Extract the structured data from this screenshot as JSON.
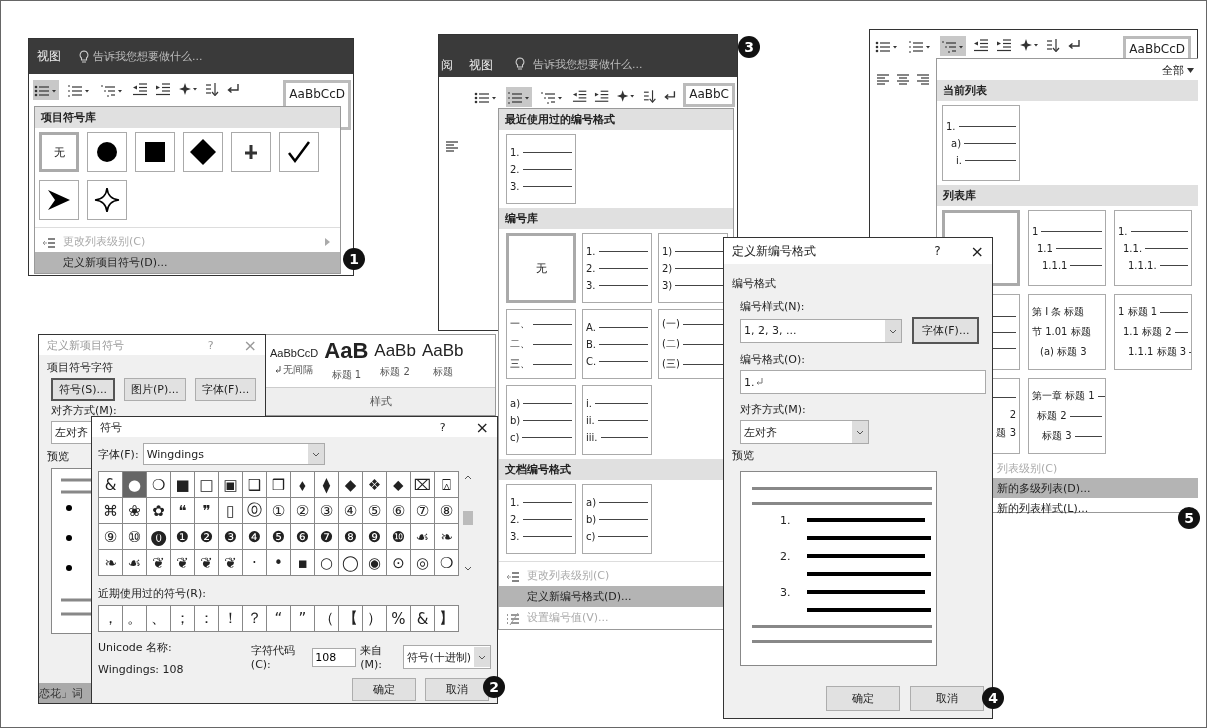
{
  "bullet_window": {
    "step": "1",
    "tabs": [
      "视图"
    ],
    "search": {
      "placeholder": "告诉我您想要做什么..."
    },
    "style_preview": "AaBbCcD",
    "toolbar_buttons": [
      {
        "kind": "bullets",
        "active": true
      },
      {
        "kind": "numbering",
        "active": false
      },
      {
        "kind": "multilevel",
        "active": false
      }
    ],
    "menu": {
      "heading": "项目符号库",
      "symbols": [
        {
          "kind": "none",
          "label": "无",
          "selected": true
        },
        {
          "kind": "disc",
          "selected": false
        },
        {
          "kind": "square",
          "selected": false
        },
        {
          "kind": "diamond",
          "selected": false
        },
        {
          "kind": "cross",
          "selected": false
        },
        {
          "kind": "check",
          "selected": false
        },
        {
          "kind": "arrowhead",
          "selected": false
        },
        {
          "kind": "star",
          "selected": false
        }
      ],
      "items": [
        {
          "label": "更改列表级别(C)",
          "disabled": true,
          "selected": false,
          "submenu": true
        },
        {
          "label": "定义新项目符号(D)...",
          "disabled": false,
          "selected": true,
          "submenu": false
        }
      ]
    }
  },
  "numbering_window": {
    "step": "3",
    "tabs": [
      "阅",
      "视图"
    ],
    "search": {
      "placeholder": "告诉我您想要做什么..."
    },
    "style_preview": "AaBbC",
    "toolbar_buttons": [
      {
        "kind": "bullets",
        "active": false
      },
      {
        "kind": "numbering",
        "active": true
      },
      {
        "kind": "multilevel",
        "active": false
      }
    ],
    "menu": {
      "sections": [
        {
          "heading": "最近使用过的编号格式",
          "tiles": [
            {
              "kind": "lines",
              "lines": [
                "1.",
                "2.",
                "3."
              ],
              "selected": false
            }
          ]
        },
        {
          "heading": "编号库",
          "tiles": [
            {
              "kind": "none",
              "label": "无",
              "selected": true
            },
            {
              "kind": "lines",
              "lines": [
                "1.",
                "2.",
                "3."
              ],
              "selected": false
            },
            {
              "kind": "lines",
              "lines": [
                "1)",
                "2)",
                "3)"
              ],
              "selected": false
            },
            {
              "kind": "lines",
              "lines": [
                "一、",
                "二、",
                "三、"
              ],
              "selected": false
            },
            {
              "kind": "lines",
              "lines": [
                "A.",
                "B.",
                "C."
              ],
              "selected": false
            },
            {
              "kind": "lines",
              "lines": [
                "(一)",
                "(二)",
                "(三)"
              ],
              "selected": false
            },
            {
              "kind": "lines",
              "lines": [
                "a)",
                "b)",
                "c)"
              ],
              "selected": false
            },
            {
              "kind": "lines",
              "lines": [
                "i.",
                "ii.",
                "iii."
              ],
              "selected": false
            }
          ]
        },
        {
          "heading": "文档编号格式",
          "tiles": [
            {
              "kind": "lines",
              "lines": [
                "1.",
                "2.",
                "3."
              ],
              "selected": false
            },
            {
              "kind": "lines",
              "lines": [
                "a)",
                "b)",
                "c)"
              ],
              "selected": false
            }
          ]
        }
      ],
      "items": [
        {
          "label": "更改列表级别(C)",
          "disabled": true,
          "selected": false
        },
        {
          "label": "定义新编号格式(D)...",
          "disabled": false,
          "selected": true
        },
        {
          "label": "设置编号值(V)...",
          "disabled": true,
          "selected": false
        }
      ]
    }
  },
  "multilevel_window": {
    "step": "5",
    "style_preview": "AaBbCcD",
    "toolbar_buttons": [
      {
        "kind": "bullets",
        "active": false
      },
      {
        "kind": "numbering",
        "active": false
      },
      {
        "kind": "multilevel",
        "active": true
      }
    ],
    "menu": {
      "filter": "全部",
      "sections": [
        {
          "heading": "当前列表",
          "tiles": [
            {
              "kind": "lines",
              "lines": [
                "1.",
                "a)",
                "i."
              ],
              "selected": false
            }
          ]
        },
        {
          "heading": "列表库",
          "tiles": [
            {
              "kind": "none",
              "selected": true
            },
            {
              "kind": "lines",
              "lines": [
                "1",
                "1.1",
                "1.1.1"
              ],
              "selected": false
            },
            {
              "kind": "lines",
              "lines": [
                "1.",
                "1.1.",
                "1.1.1."
              ],
              "selected": false
            },
            {
              "kind": "blank_lines",
              "selected": false
            },
            {
              "kind": "text",
              "lines": [
                "第 I 条 标题",
                "节 1.01 标题",
                "(a) 标题 3"
              ],
              "selected": false
            },
            {
              "kind": "lines",
              "lines": [
                "1 标题 1",
                "1.1 标题 2",
                "1.1.1 标题 3"
              ],
              "selected": false
            },
            {
              "kind": "clipped",
              "lines": [
                "2",
                "题 3"
              ],
              "selected": false
            },
            {
              "kind": "lines",
              "lines": [
                "第一章 标题 1",
                "标题 2",
                "标题 3"
              ],
              "selected": false
            }
          ]
        }
      ],
      "items": [
        {
          "label": "列表级别(C)",
          "disabled": true,
          "selected": false
        },
        {
          "label": "新的多级列表(D)...",
          "disabled": false,
          "selected": true
        },
        {
          "label": "新的列表样式(L)...",
          "disabled": false,
          "selected": false
        }
      ]
    }
  },
  "define_bullet_dialog": {
    "step": "2",
    "title": "定义新项目符号",
    "help": "?",
    "close": "×",
    "group": "项目符号字符",
    "buttons": [
      {
        "label": "符号(S)...",
        "default": true
      },
      {
        "label": "图片(P)...",
        "default": false
      },
      {
        "label": "字体(F)...",
        "default": false
      }
    ],
    "alignment_label": "对齐方式(M):",
    "alignment_value": "左对齐",
    "preview_label": "预览",
    "document_text": "恋花」词"
  },
  "styles_gallery": {
    "styles": [
      {
        "kind": "normal",
        "preview": "AaBbCcD",
        "name": "无间隔"
      },
      {
        "kind": "heading1",
        "preview": "AaB",
        "name": "标题 1"
      },
      {
        "kind": "heading2",
        "preview": "AaBb",
        "name": "标题 2"
      },
      {
        "kind": "title",
        "preview": "AaBb",
        "name": "标题"
      }
    ],
    "group_label": "样式"
  },
  "symbol_dialog": {
    "title": "符号",
    "help": "?",
    "close": "×",
    "font_label": "字体(F):",
    "font_value": "Wingdings",
    "rows": [
      [
        {
          "char": "&",
          "selected": false
        },
        {
          "char": "●",
          "selected": true
        },
        {
          "char": "❍",
          "selected": false
        },
        {
          "char": "■",
          "selected": false
        },
        {
          "char": "□",
          "selected": false
        },
        {
          "char": "▣",
          "selected": false
        },
        {
          "char": "❑",
          "selected": false
        },
        {
          "char": "❒",
          "selected": false
        },
        {
          "char": "⬧",
          "selected": false
        },
        {
          "char": "⧫",
          "selected": false
        },
        {
          "char": "◆",
          "selected": false
        },
        {
          "char": "❖",
          "selected": false
        },
        {
          "char": "⬥",
          "selected": false
        },
        {
          "char": "⌧",
          "selected": false
        },
        {
          "char": "⍓",
          "selected": false
        }
      ],
      [
        {
          "char": "⌘",
          "selected": false
        },
        {
          "char": "❀",
          "selected": false
        },
        {
          "char": "✿",
          "selected": false
        },
        {
          "char": "❝",
          "selected": false
        },
        {
          "char": "❞",
          "selected": false
        },
        {
          "char": "▯",
          "selected": false
        },
        {
          "char": "⓪",
          "selected": false
        },
        {
          "char": "①",
          "selected": false
        },
        {
          "char": "②",
          "selected": false
        },
        {
          "char": "③",
          "selected": false
        },
        {
          "char": "④",
          "selected": false
        },
        {
          "char": "⑤",
          "selected": false
        },
        {
          "char": "⑥",
          "selected": false
        },
        {
          "char": "⑦",
          "selected": false
        },
        {
          "char": "⑧",
          "selected": false
        }
      ],
      [
        {
          "char": "⑨",
          "selected": false
        },
        {
          "char": "⑩",
          "selected": false
        },
        {
          "char": "⓿",
          "selected": false
        },
        {
          "char": "❶",
          "selected": false
        },
        {
          "char": "❷",
          "selected": false
        },
        {
          "char": "❸",
          "selected": false
        },
        {
          "char": "❹",
          "selected": false
        },
        {
          "char": "❺",
          "selected": false
        },
        {
          "char": "❻",
          "selected": false
        },
        {
          "char": "❼",
          "selected": false
        },
        {
          "char": "❽",
          "selected": false
        },
        {
          "char": "❾",
          "selected": false
        },
        {
          "char": "❿",
          "selected": false
        },
        {
          "char": "☙",
          "selected": false
        },
        {
          "char": "❧",
          "selected": false
        }
      ],
      [
        {
          "char": "❧",
          "selected": false
        },
        {
          "char": "☙",
          "selected": false
        },
        {
          "char": "❦",
          "selected": false
        },
        {
          "char": "❦",
          "selected": false
        },
        {
          "char": "❦",
          "selected": false
        },
        {
          "char": "❦",
          "selected": false
        },
        {
          "char": "·",
          "selected": false
        },
        {
          "char": "•",
          "selected": false
        },
        {
          "char": "▪",
          "selected": false
        },
        {
          "char": "○",
          "selected": false
        },
        {
          "char": "◯",
          "selected": false
        },
        {
          "char": "◉",
          "selected": false
        },
        {
          "char": "⊙",
          "selected": false
        },
        {
          "char": "◎",
          "selected": false
        },
        {
          "char": "❍",
          "selected": false
        }
      ]
    ],
    "recent_label": "近期使用过的符号(R):",
    "recent": [
      "，",
      "。",
      "、",
      "；",
      "：",
      "！",
      "？",
      "“",
      "”",
      "（",
      "【",
      "）",
      "%",
      "&",
      "】"
    ],
    "unicode_name_label": "Unicode 名称:",
    "unicode_name": "Wingdings: 108",
    "code_label": "字符代码(C):",
    "code_value": "108",
    "from_label": "来自(M):",
    "from_value": "符号(十进制)",
    "buttons": [
      "确定",
      "取消"
    ]
  },
  "define_number_dialog": {
    "step": "4",
    "title": "定义新编号格式",
    "help": "?",
    "close": "×",
    "section": "编号格式",
    "style_label": "编号样式(N):",
    "style_value": "1, 2, 3, ...",
    "font_button": "字体(F)...",
    "format_label": "编号格式(O):",
    "format_value": "1.",
    "align_label": "对齐方式(M):",
    "align_value": "左对齐",
    "preview_label": "预览",
    "preview_numbers": [
      "1.",
      "2.",
      "3."
    ],
    "buttons": [
      "确定",
      "取消"
    ]
  }
}
